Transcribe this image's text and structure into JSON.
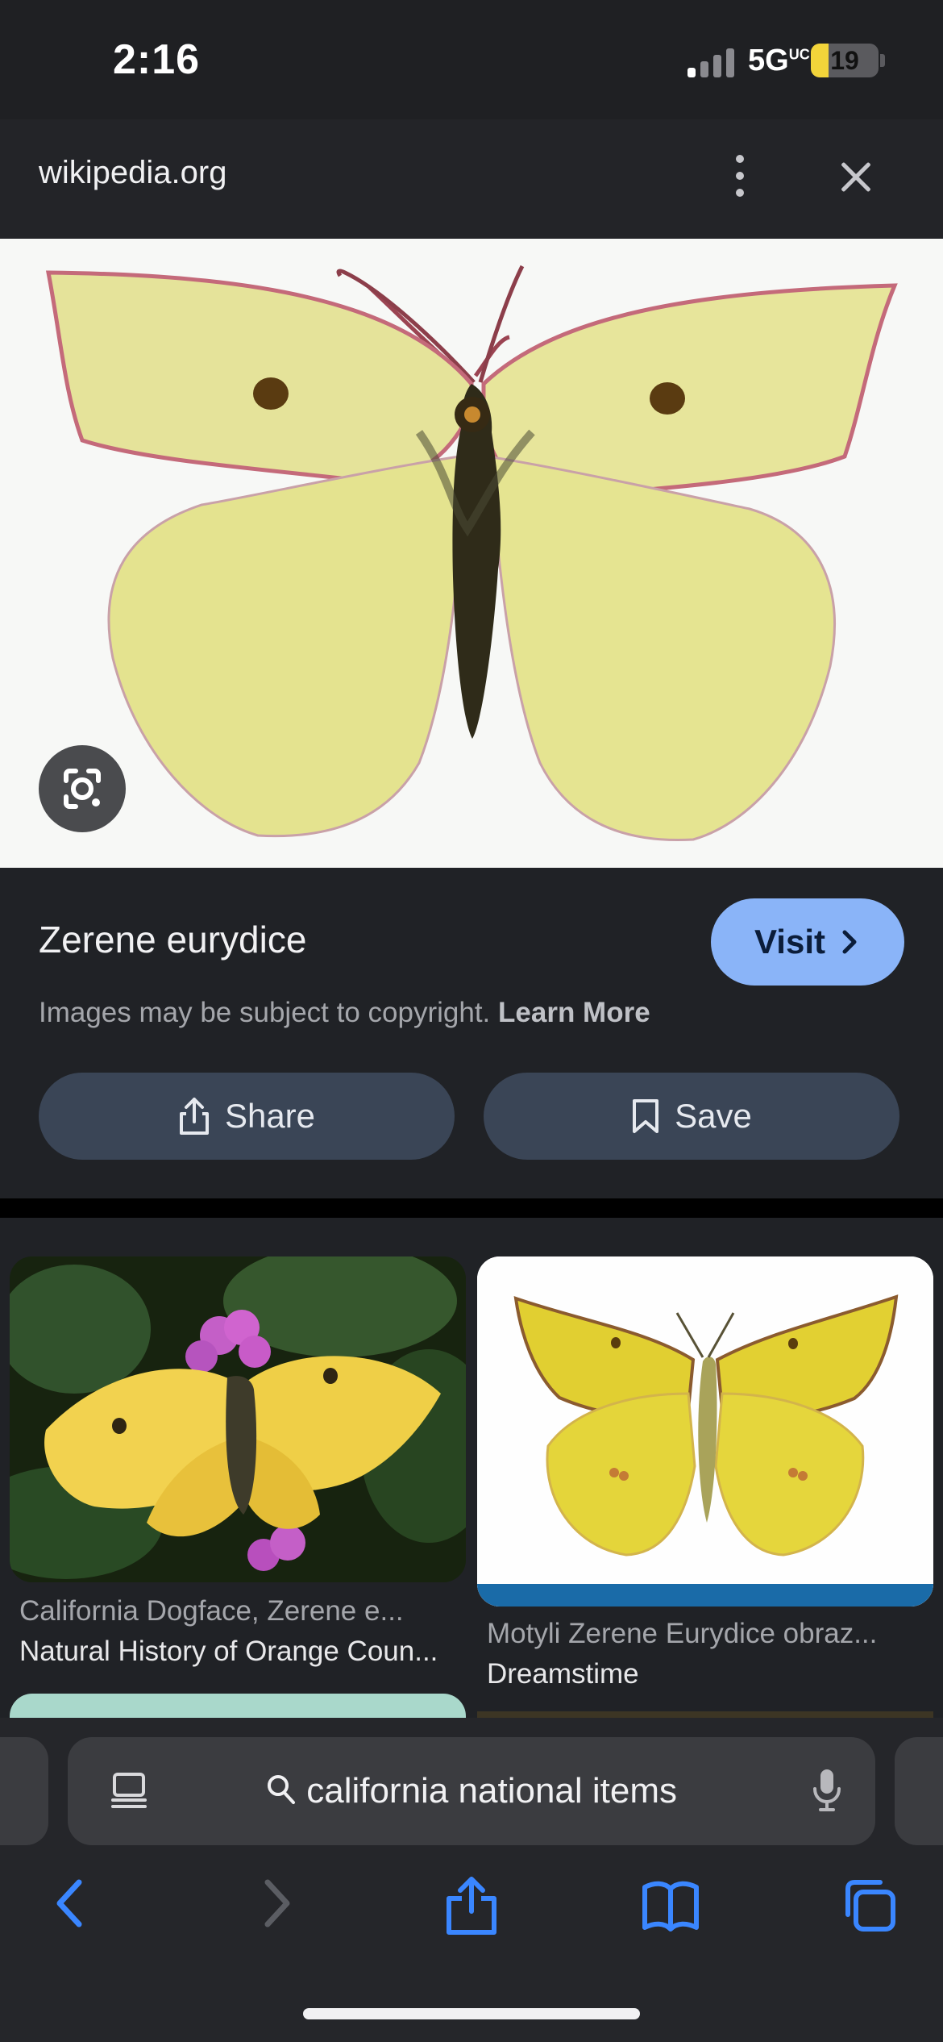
{
  "status_bar": {
    "time": "2:16",
    "network": "5G",
    "network_suffix": "UC",
    "battery": "19"
  },
  "header": {
    "site": "wikipedia.org"
  },
  "hero": {
    "icon": "lens-icon"
  },
  "result": {
    "title": "Zerene eurydice",
    "visit_label": "Visit",
    "copyright_text": "Images may be subject to copyright.",
    "learn_more": "Learn More",
    "share_label": "Share",
    "save_label": "Save"
  },
  "related": [
    {
      "title": "California Dogface, Zerene e...",
      "source": "Natural History of Orange Coun..."
    },
    {
      "title": "Motyli Zerene Eurydice obraz...",
      "source": "Dreamstime"
    }
  ],
  "address_bar": {
    "query": "california national items"
  },
  "toolbar": {
    "icons": [
      "back-icon",
      "forward-icon",
      "share-icon",
      "bookmarks-icon",
      "tabs-icon"
    ]
  },
  "colors": {
    "accent": "#8ab4f8",
    "ios_blue": "#3a86ff",
    "butterfly_yellow": "#e7e59a"
  }
}
